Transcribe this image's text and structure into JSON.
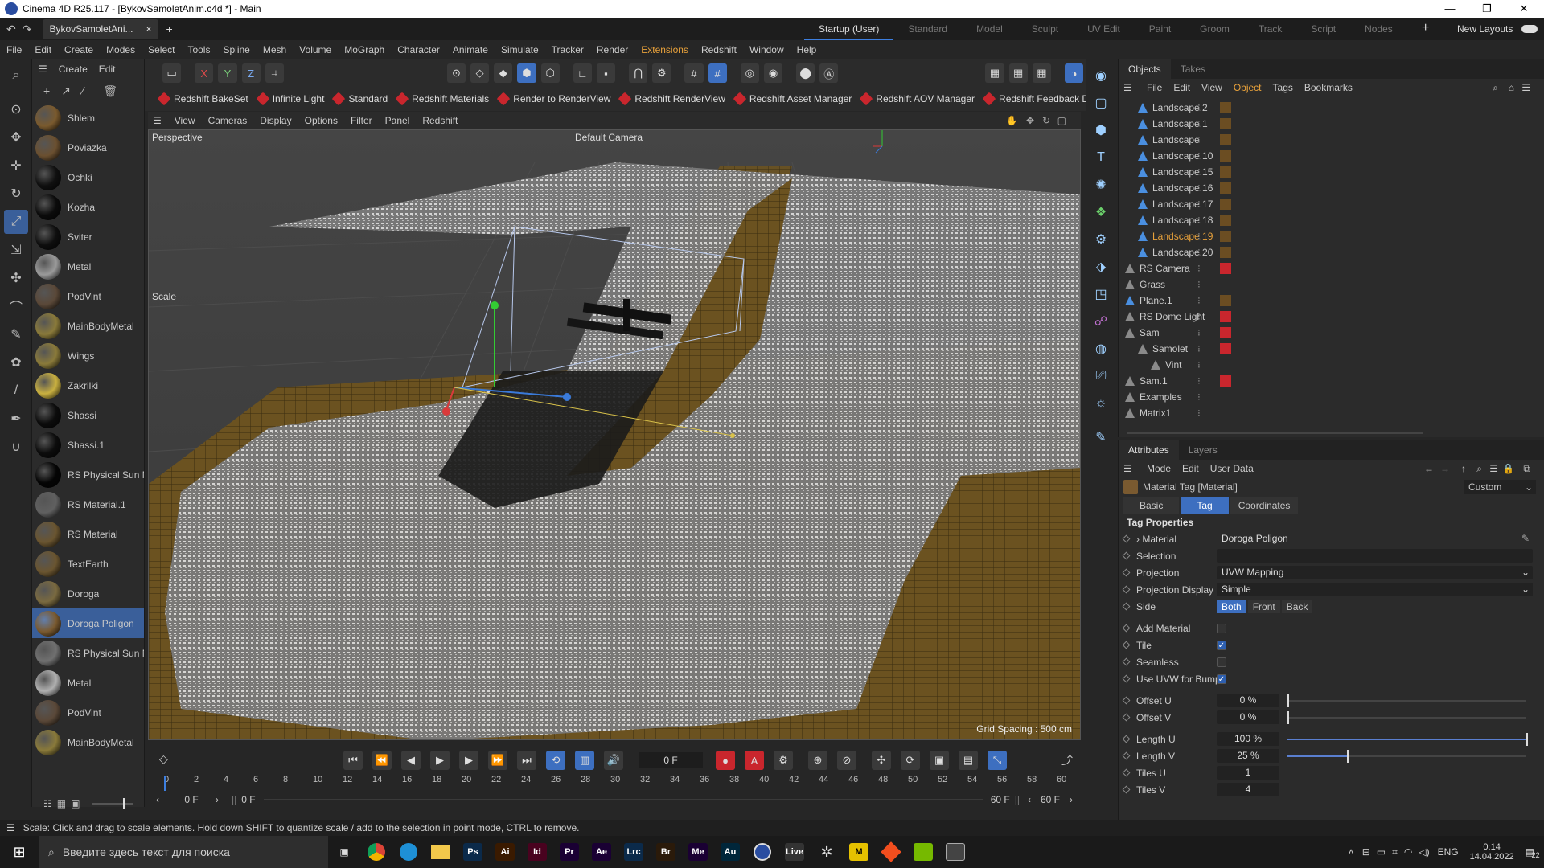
{
  "window": {
    "title": "Cinema 4D R25.117 - [BykovSamoletAnim.c4d *] - Main",
    "min": "—",
    "max": "❐",
    "close": "✕"
  },
  "doc_tab": {
    "label": "BykovSamoletAni...",
    "close": "×",
    "add": "+"
  },
  "layouts": {
    "items": [
      "Startup (User)",
      "Standard",
      "Model",
      "Sculpt",
      "UV Edit",
      "Paint",
      "Groom",
      "Track",
      "Script",
      "Nodes"
    ],
    "new": "New Layouts"
  },
  "menu": [
    "File",
    "Edit",
    "Create",
    "Modes",
    "Select",
    "Tools",
    "Spline",
    "Mesh",
    "Volume",
    "MoGraph",
    "Character",
    "Animate",
    "Simulate",
    "Tracker",
    "Render",
    "Extensions",
    "Redshift",
    "Window",
    "Help"
  ],
  "mat_menu": {
    "create": "Create",
    "edit": "Edit"
  },
  "materials": [
    {
      "name": "Shlem",
      "color": "#7a5a2e"
    },
    {
      "name": "Poviazka",
      "color": "#6b5030"
    },
    {
      "name": "Ochki",
      "color": "#101010"
    },
    {
      "name": "Kozha",
      "color": "#0b0b0b"
    },
    {
      "name": "Sviter",
      "color": "#0e0e0e"
    },
    {
      "name": "Metal",
      "color": "#9a9a9a"
    },
    {
      "name": "PodVint",
      "color": "#5a4838"
    },
    {
      "name": "MainBodyMetal",
      "color": "#8a7a3a"
    },
    {
      "name": "Wings",
      "color": "#8a7a3a"
    },
    {
      "name": "Zakrilki",
      "color": "#c9b040"
    },
    {
      "name": "Shassi",
      "color": "#0c0c0c"
    },
    {
      "name": "Shassi.1",
      "color": "#0c0c0c"
    },
    {
      "name": "RS Physical Sun N",
      "color": "#050505"
    },
    {
      "name": "RS Material.1",
      "color": "#606060"
    },
    {
      "name": "RS Material",
      "color": "#6a5530"
    },
    {
      "name": "TextEarth",
      "color": "#6a5530"
    },
    {
      "name": "Doroga",
      "color": "#7a6a40"
    },
    {
      "name": "Doroga Poligon",
      "color": "#7a5a30"
    },
    {
      "name": "RS Physical Sun N",
      "color": "#707070"
    },
    {
      "name": "Metal",
      "color": "#b0b0b0"
    },
    {
      "name": "PodVint",
      "color": "#5a4838"
    },
    {
      "name": "MainBodyMetal",
      "color": "#8a7a3a"
    }
  ],
  "rs_toolbar": [
    "Redshift BakeSet",
    "Infinite Light",
    "Standard",
    "Redshift Materials",
    "Render to RenderView",
    "Redshift RenderView",
    "Redshift Asset Manager",
    "Redshift AOV Manager",
    "Redshift Feedback Display"
  ],
  "viewport_menu": [
    "View",
    "Cameras",
    "Display",
    "Options",
    "Filter",
    "Panel",
    "Redshift"
  ],
  "viewport": {
    "label": "Perspective",
    "camera": "Default Camera",
    "tool": "Scale",
    "grid": "Grid Spacing : 500 cm"
  },
  "timeline": {
    "frame": "0 F",
    "ruler": [
      "0",
      "2",
      "4",
      "6",
      "8",
      "10",
      "12",
      "14",
      "16",
      "18",
      "20",
      "22",
      "24",
      "26",
      "28",
      "30",
      "32",
      "34",
      "36",
      "38",
      "40",
      "42",
      "44",
      "46",
      "48",
      "50",
      "52",
      "54",
      "56",
      "58",
      "60"
    ],
    "start": "0 F",
    "start2": "0 F",
    "end": "60 F",
    "end2": "60 F"
  },
  "status": "Scale: Click and drag to scale elements. Hold down SHIFT to quantize scale / add to the selection in point mode, CTRL to remove.",
  "objects_tabs": {
    "objects": "Objects",
    "takes": "Takes"
  },
  "objects_menu": [
    "File",
    "Edit",
    "View",
    "Object",
    "Tags",
    "Bookmarks"
  ],
  "objects": [
    {
      "name": "Landscape.2",
      "indent": 1,
      "sel": false,
      "blue": true
    },
    {
      "name": "Landscape.1",
      "indent": 1,
      "sel": false,
      "blue": true
    },
    {
      "name": "Landscape",
      "indent": 1,
      "sel": false,
      "blue": true
    },
    {
      "name": "Landscape.10",
      "indent": 1,
      "sel": false,
      "blue": true
    },
    {
      "name": "Landscape.15",
      "indent": 1,
      "sel": false,
      "blue": true
    },
    {
      "name": "Landscape.16",
      "indent": 1,
      "sel": false,
      "blue": true
    },
    {
      "name": "Landscape.17",
      "indent": 1,
      "sel": false,
      "blue": true
    },
    {
      "name": "Landscape.18",
      "indent": 1,
      "sel": false,
      "blue": true
    },
    {
      "name": "Landscape.19",
      "indent": 1,
      "sel": true,
      "blue": true
    },
    {
      "name": "Landscape.20",
      "indent": 1,
      "sel": false,
      "blue": true
    },
    {
      "name": "RS Camera",
      "indent": 0,
      "sel": false,
      "blue": false
    },
    {
      "name": "Grass",
      "indent": 0,
      "sel": false,
      "blue": false
    },
    {
      "name": "Plane.1",
      "indent": 0,
      "sel": false,
      "blue": true
    },
    {
      "name": "RS Dome Light",
      "indent": 0,
      "sel": false,
      "blue": false
    },
    {
      "name": "Sam",
      "indent": 0,
      "sel": false,
      "blue": false
    },
    {
      "name": "Samolet",
      "indent": 1,
      "sel": false,
      "blue": false
    },
    {
      "name": "Vint",
      "indent": 2,
      "sel": false,
      "blue": false
    },
    {
      "name": "Sam.1",
      "indent": 0,
      "sel": false,
      "blue": false
    },
    {
      "name": "Examples",
      "indent": 0,
      "sel": false,
      "blue": false
    },
    {
      "name": "Matrix1",
      "indent": 0,
      "sel": false,
      "blue": false
    }
  ],
  "attrs_tabs": {
    "attributes": "Attributes",
    "layers": "Layers"
  },
  "attrs_menu": [
    "Mode",
    "Edit",
    "User Data"
  ],
  "attrs_title": "Material Tag [Material]",
  "attrs_preset": "Custom",
  "attr_subtabs": [
    "Basic",
    "Tag",
    "Coordinates"
  ],
  "tag_props": {
    "heading": "Tag Properties",
    "material_label": "Material",
    "material_value": "Doroga Poligon",
    "selection_label": "Selection",
    "projection_label": "Projection",
    "projection_value": "UVW Mapping",
    "projdisp_label": "Projection Display",
    "projdisp_value": "Simple",
    "side_label": "Side",
    "side_opts": [
      "Both",
      "Front",
      "Back"
    ],
    "addmat_label": "Add Material",
    "tile_label": "Tile",
    "seamless_label": "Seamless",
    "uvwbump_label": "Use UVW for Bump",
    "offu_label": "Offset U",
    "offu_value": "0 %",
    "offu_frac": 0,
    "offv_label": "Offset V",
    "offv_value": "0 %",
    "offv_frac": 0,
    "lenu_label": "Length U",
    "lenu_value": "100 %",
    "lenu_frac": 1.0,
    "lenv_label": "Length V",
    "lenv_value": "25 %",
    "lenv_frac": 0.25,
    "tilesu_label": "Tiles U",
    "tilesu_value": "1",
    "tilesv_label": "Tiles V",
    "tilesv_value": "4"
  },
  "taskbar": {
    "search_placeholder": "Введите здесь текст для поиска",
    "apps": [
      {
        "label": "Ps",
        "color": "#0b2a4a"
      },
      {
        "label": "Ai",
        "color": "#3a1a00"
      },
      {
        "label": "Id",
        "color": "#49021f"
      },
      {
        "label": "Pr",
        "color": "#1a0033"
      },
      {
        "label": "Ae",
        "color": "#1a0033"
      },
      {
        "label": "Lrc",
        "color": "#0b2a4a"
      },
      {
        "label": "Br",
        "color": "#2a1a0a"
      },
      {
        "label": "Me",
        "color": "#1a0033"
      },
      {
        "label": "Au",
        "color": "#00263a"
      }
    ],
    "lang": "ENG",
    "time": "0:14",
    "date": "14.04.2022",
    "notif": "22"
  }
}
